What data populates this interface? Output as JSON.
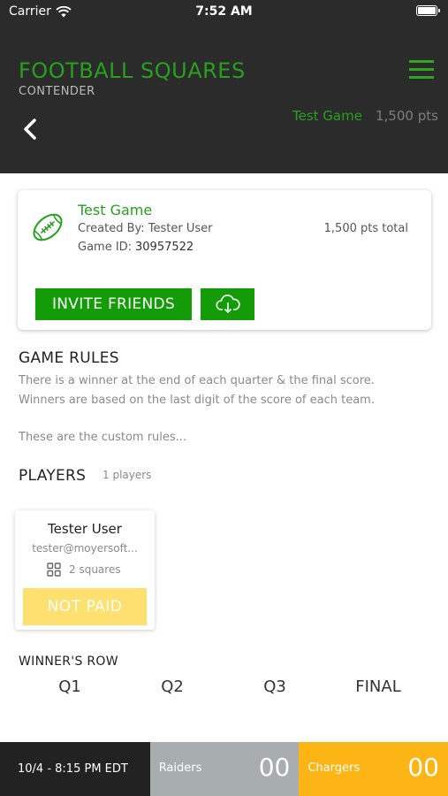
{
  "status_bar": {
    "carrier": "Carrier",
    "time": "7:52 AM"
  },
  "header": {
    "title": "FOOTBALL SQUARES",
    "subtitle": "CONTENDER",
    "game_name": "Test Game",
    "game_points": "1,500 pts"
  },
  "game_card": {
    "name": "Test Game",
    "created_by": "Created By: Tester User",
    "game_id_label": "Game ID:",
    "game_id": "30957522",
    "total_points": "1,500 pts total",
    "invite_label": "INVITE FRIENDS",
    "icons": {
      "football": "football-icon",
      "cloud": "cloud-download-icon"
    }
  },
  "rules": {
    "title": "GAME RULES",
    "line1": "There is a winner at the end of each quarter & the final score.",
    "line2": "Winners are based on the last digit of the score of each team.",
    "custom": "These are the custom rules..."
  },
  "players": {
    "title": "PLAYERS",
    "count": "1 players",
    "list": [
      {
        "name": "Tester User",
        "email": "tester@moyersoft...",
        "squares": "2 squares",
        "status": "NOT PAID"
      }
    ]
  },
  "winners": {
    "title": "WINNER'S ROW",
    "quarters": [
      "Q1",
      "Q2",
      "Q3",
      "FINAL"
    ]
  },
  "scoreboard": {
    "date": "10/4 - 8:15 PM EDT",
    "home": {
      "name": "Raiders",
      "score": "00",
      "color": "#a8adb0"
    },
    "away": {
      "name": "Chargers",
      "score": "00",
      "color": "#fdb515"
    }
  },
  "colors": {
    "header_bg": "#2b2b2b",
    "accent_green": "#27a01f",
    "button_green": "#139b08",
    "not_paid_yellow": "#fee070"
  }
}
